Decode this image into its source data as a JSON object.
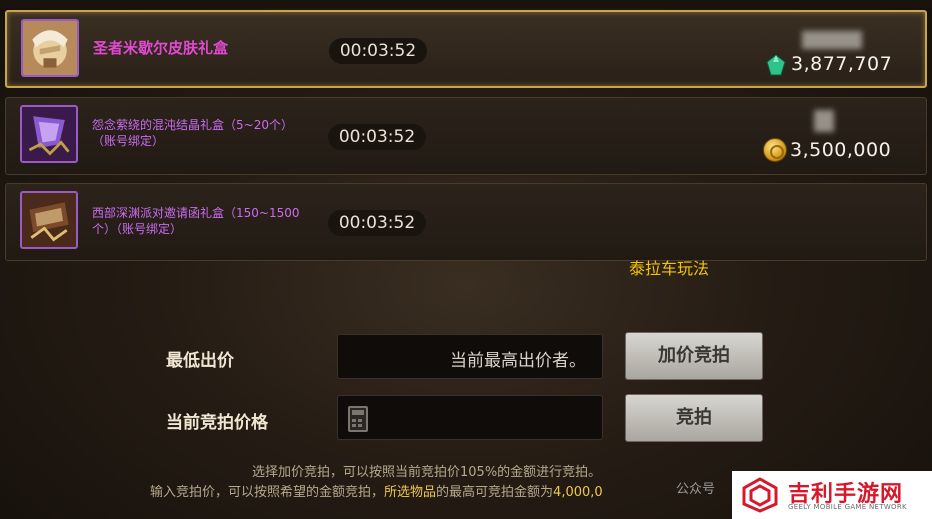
{
  "items": [
    {
      "name": "圣者米歇尔皮肤礼盒",
      "timer": "00:03:52",
      "price": "3,877,707",
      "currency_icon": "gem-icon"
    },
    {
      "name_line1": "怨念萦绕的混沌结晶礼盒（5~20个）",
      "name_line2": "（账号绑定）",
      "timer": "00:03:52",
      "price": "3,500,000",
      "currency_icon": "gold-coin-icon"
    },
    {
      "name_line1": "西部深渊派对邀请函礼盒（150~1500",
      "name_line2": "个）（账号绑定）",
      "timer": "00:03:52"
    }
  ],
  "watermark": "泰拉车玩法",
  "bid_form": {
    "min_bid_label": "最低出价",
    "min_bid_value": "当前最高出价者。",
    "raise_button": "加价竞拍",
    "current_price_label": "当前竞拍价格",
    "bid_button": "竞拍"
  },
  "notes": {
    "line1": "选择加价竞拍，可以按照当前竞拍价105%的金额进行竞拍。",
    "line2_a": "输入竞拍价，可以按照希望的金额竞拍，",
    "line2_highlight": "所选物品",
    "line2_b": "的最高可竞拍金额为",
    "line2_value": "4,000,0"
  },
  "wechat_mark": "公众号",
  "logo": {
    "title": "吉利手游网",
    "subtitle": "GEELY MOBILE GAME NETWORK"
  },
  "colors": {
    "accent_gold": "#c9a44a",
    "item_name_purple": "#c96cf0",
    "selected_name_pink": "#e04ad0",
    "watermark_yellow": "#f2c500",
    "logo_red": "#d8182a"
  }
}
